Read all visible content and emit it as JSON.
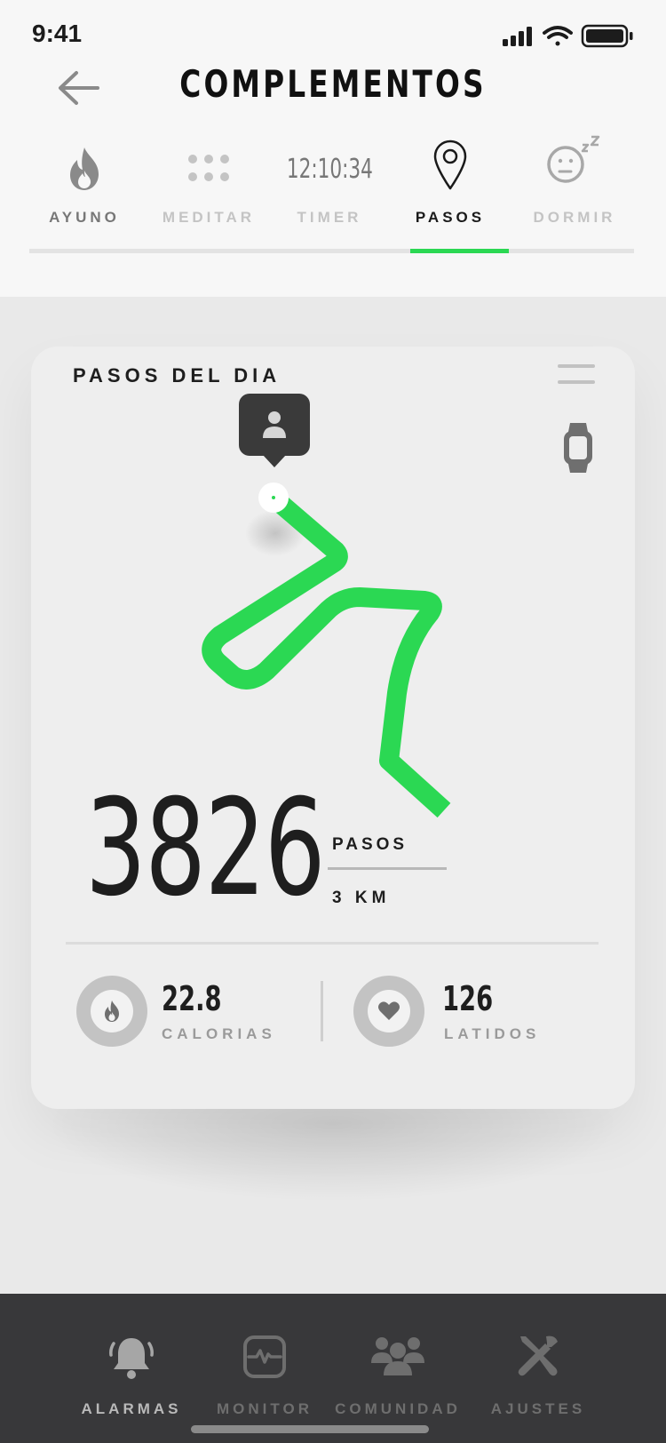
{
  "status_bar": {
    "time": "9:41"
  },
  "header": {
    "title": "COMPLEMENTOS"
  },
  "tabs": [
    {
      "label": "AYUNO",
      "icon": "flame-icon"
    },
    {
      "label": "MEDITAR",
      "icon": "dots-icon"
    },
    {
      "label": "TIMER",
      "value": "12:10:34"
    },
    {
      "label": "PASOS",
      "icon": "map-pin-icon",
      "active": true
    },
    {
      "label": "DORMIR",
      "icon": "sleep-face-icon"
    }
  ],
  "card": {
    "title": "PASOS DEL DIA",
    "steps": "3826",
    "steps_unit": "PASOS",
    "distance": "3 KM",
    "stats": [
      {
        "value": "22.8",
        "label": "CALORIAS",
        "icon": "flame-icon"
      },
      {
        "value": "126",
        "label": "LATIDOS",
        "icon": "heart-icon"
      }
    ]
  },
  "bottom_nav": [
    {
      "label": "ALARMAS",
      "icon": "bell-icon",
      "active": true
    },
    {
      "label": "MONITOR",
      "icon": "monitor-icon"
    },
    {
      "label": "COMUNIDAD",
      "icon": "community-icon"
    },
    {
      "label": "AJUSTES",
      "icon": "tools-icon"
    }
  ],
  "colors": {
    "accent": "#2bd853",
    "nav_bg": "#38383a",
    "card_bg": "#eeeeee"
  }
}
